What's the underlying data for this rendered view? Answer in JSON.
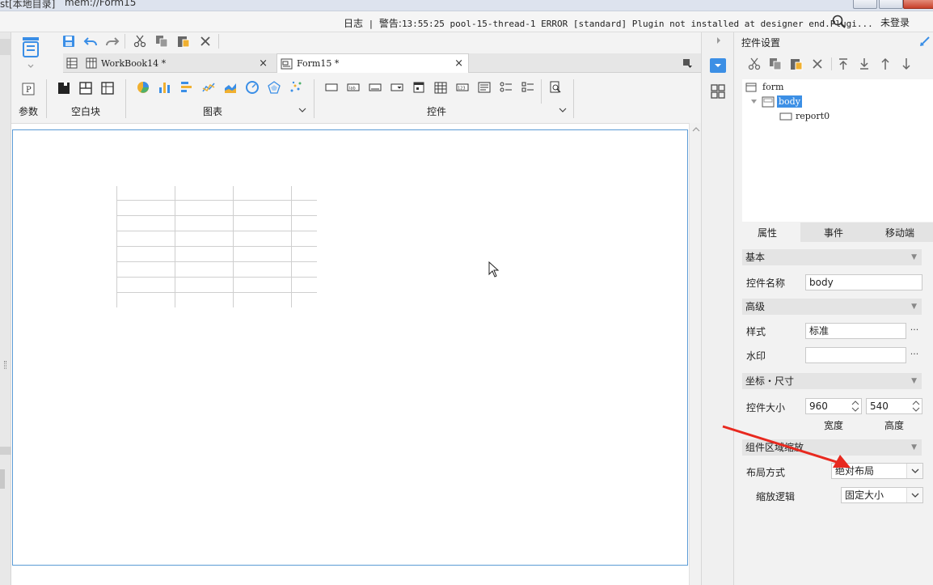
{
  "titlebar": {
    "left_text": "st[本地目录]",
    "file": "mem://Form15"
  },
  "logbar": {
    "log_label": "日志",
    "warning_label": "警告:",
    "message": "13:55:25 pool-15-thread-1 ERROR [standard] Plugin not installed at designer end.Plugi...",
    "login": "未登录"
  },
  "tabs": [
    {
      "label": "WorkBook14 *",
      "icon": "workbook-icon"
    },
    {
      "label": "Form15 *",
      "icon": "form-icon"
    }
  ],
  "toolbar": {
    "groups": {
      "param": "参数",
      "blank": "空白块",
      "chart": "图表",
      "widget": "控件"
    }
  },
  "right_panel": {
    "title": "控件设置",
    "tree": {
      "root": "form",
      "body": "body",
      "child": "report0"
    },
    "tabs": [
      "属性",
      "事件",
      "移动端"
    ],
    "sections": {
      "basic": "基本",
      "advanced": "高级",
      "coords": "坐标・尺寸",
      "scale": "组件区域缩放"
    },
    "fields": {
      "name_label": "控件名称",
      "name_value": "body",
      "style_label": "样式",
      "style_value": "标准",
      "watermark_label": "水印",
      "watermark_value": "",
      "size_label": "控件大小",
      "width_value": "960",
      "height_value": "540",
      "width_label": "宽度",
      "height_label": "高度",
      "layout_label": "布局方式",
      "layout_value": "绝对布局",
      "scale_logic_label": "缩放逻辑",
      "scale_logic_value": "固定大小"
    }
  },
  "colors": {
    "accent": "#5b9bd5",
    "selection": "#3c8fe5",
    "arrow": "#e8291f"
  }
}
